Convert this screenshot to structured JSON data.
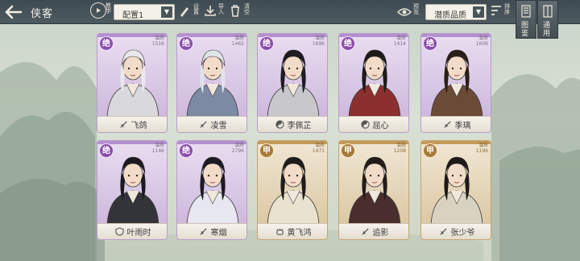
{
  "header": {
    "title": "侠客",
    "tutorial_label": "教学",
    "config_dropdown": "配置1",
    "tool_labels": [
      "设置",
      "导入",
      "清空"
    ],
    "preview_label": "预览",
    "filter_dropdown": "潜质品质",
    "sort_label": "排序"
  },
  "side_tabs": [
    {
      "label": "图鉴"
    },
    {
      "label": "通用"
    }
  ],
  "colors": {
    "purple_tier": "#8a4ea8",
    "gold_tier": "#a87a3a",
    "topbar": "#444f54"
  },
  "characters": [
    {
      "name": "飞鸽",
      "rank": "绝",
      "tier": "purple",
      "power_label": "潜质",
      "power": "1516",
      "icon": "sword-icon"
    },
    {
      "name": "凌雪",
      "rank": "绝",
      "tier": "purple",
      "power_label": "潜质",
      "power": "1462",
      "icon": "sword-icon"
    },
    {
      "name": "李佩芷",
      "rank": "绝",
      "tier": "purple",
      "power_label": "潜质",
      "power": "1696",
      "icon": "yinyang-icon"
    },
    {
      "name": "屈心",
      "rank": "绝",
      "tier": "purple",
      "power_label": "潜质",
      "power": "1414",
      "icon": "yinyang-icon"
    },
    {
      "name": "季璃",
      "rank": "绝",
      "tier": "purple",
      "power_label": "潜质",
      "power": "1606",
      "icon": "sword-icon"
    },
    {
      "name": "叶雨时",
      "rank": "绝",
      "tier": "purple",
      "power_label": "潜质",
      "power": "1146",
      "icon": "shield-icon"
    },
    {
      "name": "寒烟",
      "rank": "绝",
      "tier": "purple",
      "power_label": "潜质",
      "power": "2796",
      "icon": "sword-icon"
    },
    {
      "name": "黄飞鸿",
      "rank": "甲",
      "tier": "gold",
      "power_label": "潜质",
      "power": "1471",
      "icon": "fist-icon"
    },
    {
      "name": "追影",
      "rank": "甲",
      "tier": "gold",
      "power_label": "潜质",
      "power": "1208",
      "icon": "sword-icon"
    },
    {
      "name": "张少爷",
      "rank": "甲",
      "tier": "gold",
      "power_label": "潜质",
      "power": "1196",
      "icon": "sword-icon"
    }
  ]
}
